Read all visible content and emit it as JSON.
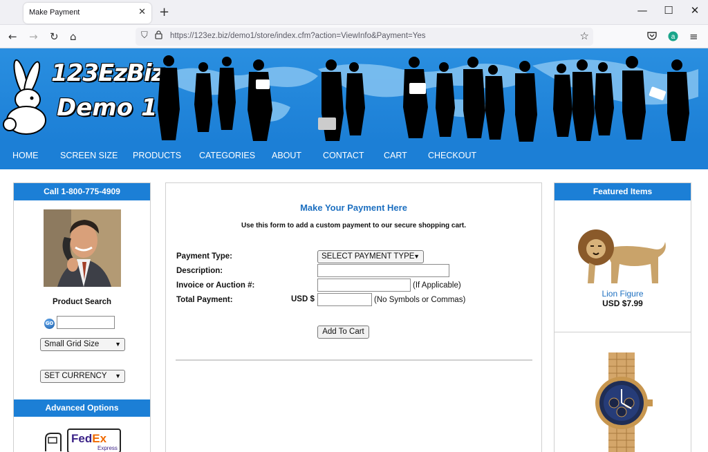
{
  "browser": {
    "tab_title": "Make Payment",
    "url": "https://123ez.biz/demo1/store/index.cfm?action=ViewInfo&Payment=Yes"
  },
  "site": {
    "logo_line1": "123EzBiz",
    "logo_line2": "Demo 1",
    "menu": [
      "HOME",
      "SCREEN SIZE",
      "PRODUCTS",
      "CATEGORIES",
      "ABOUT",
      "CONTACT",
      "CART",
      "CHECKOUT"
    ]
  },
  "left": {
    "phone": "Call 1-800-775-4909",
    "search_title": "Product Search",
    "go_label": "GO",
    "grid_select": "Small Grid Size",
    "currency_select": "SET CURRENCY",
    "advanced": "Advanced Options",
    "fedex_fed": "Fed",
    "fedex_ex": "Ex",
    "fedex_express": "Express"
  },
  "form": {
    "title": "Make Your Payment Here",
    "subtitle": "Use this form to add a custom payment to our secure shopping cart.",
    "payment_type_label": "Payment Type:",
    "payment_type_value": "SELECT PAYMENT TYPE",
    "description_label": "Description:",
    "invoice_label": "Invoice or Auction #:",
    "invoice_note": "(If Applicable)",
    "total_label": "Total Payment:",
    "currency_prefix": "USD $",
    "total_note": "(No Symbols or Commas)",
    "add_button": "Add To Cart"
  },
  "featured": {
    "title": "Featured Items",
    "item1_name": "Lion Figure",
    "item1_price": "USD $7.99"
  },
  "colors": {
    "brand_blue": "#1c7fd6",
    "link_blue": "#1c6fc0"
  }
}
